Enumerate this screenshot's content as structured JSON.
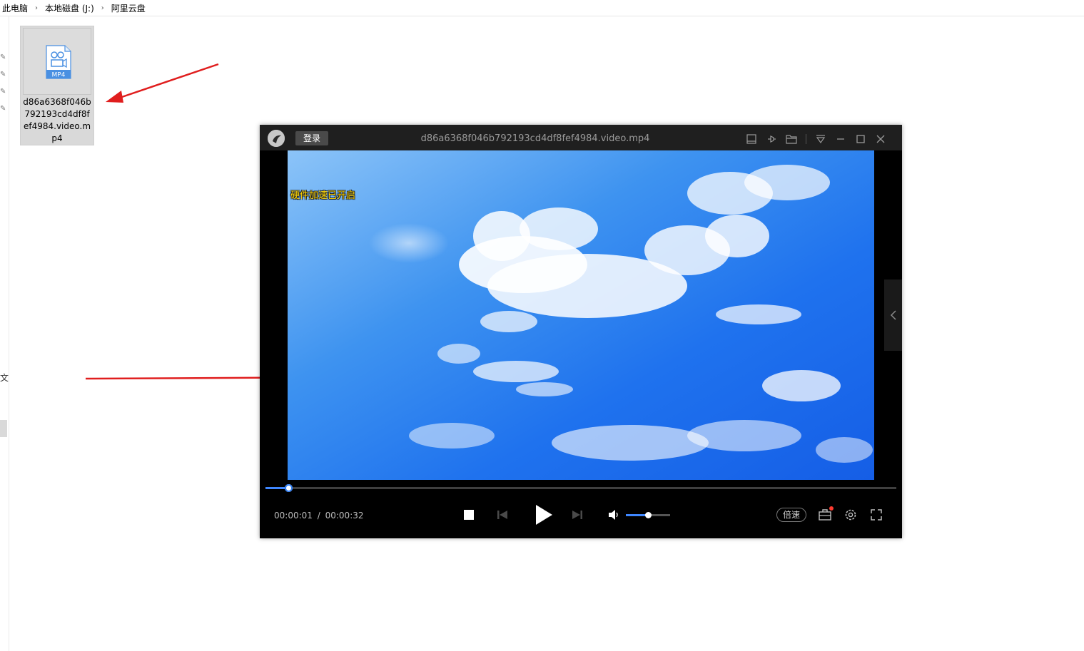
{
  "explorer": {
    "breadcrumb": [
      "此电脑",
      "本地磁盘 (J:)",
      "阿里云盘"
    ],
    "nav_fragment": "文",
    "file": {
      "badge": "MP4",
      "name": "d86a6368f046b792193cd4df8fef4984.video.mp4"
    }
  },
  "player": {
    "login_label": "登录",
    "title": "d86a6368f046b792193cd4df8fef4984.video.mp4",
    "overlay_text": "硬件加速已开启",
    "time_current": "00:00:01",
    "time_sep": "/",
    "time_total": "00:00:32",
    "progress": 0.036,
    "volume": 0.5,
    "speed_label": "倍速",
    "colors": {
      "accent": "#3f87ff",
      "titlebar_bg": "#1f1f1f",
      "overlay_text": "#ffd400",
      "annotation_arrow": "#e01e1e"
    }
  }
}
